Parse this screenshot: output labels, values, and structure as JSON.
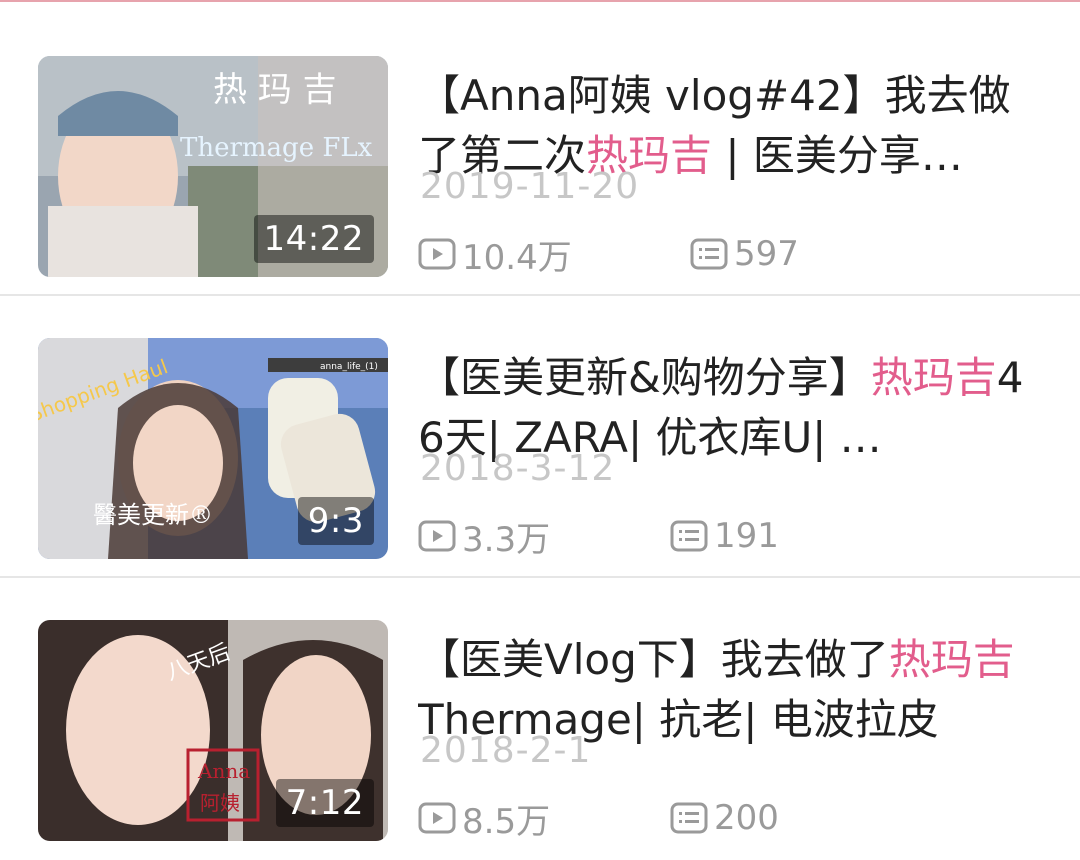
{
  "videos": [
    {
      "duration": "14:22",
      "title_before": "【Anna阿姨 vlog#42】我去做了第二次",
      "title_highlight": "热玛吉",
      "title_after": " | 医美分享…",
      "date": "2019-11-20",
      "views": "10.4万",
      "comments": "597",
      "thumb_text": [
        "热 玛 吉",
        "Thermage FLx"
      ]
    },
    {
      "duration": "9:3",
      "title_before": "【医美更新&购物分享】",
      "title_highlight": "热玛吉",
      "title_after": "46天| ZARA| 优衣库U| …",
      "date": "2018-3-12",
      "views": "3.3万",
      "comments": "191",
      "thumb_text": [
        "Shopping Haul",
        "醫美更新®",
        "anna_life_(1)"
      ]
    },
    {
      "duration": "7:12",
      "title_before": "【医美Vlog下】我去做了",
      "title_highlight": "热玛吉",
      "title_after": "Thermage| 抗老| 电波拉皮",
      "date": "2018-2-1",
      "views": "8.5万",
      "comments": "200",
      "thumb_text": [
        "八天后",
        "Anna",
        "阿姨"
      ]
    }
  ],
  "colors": {
    "highlight": "#e25d8c",
    "meta": "#9a9a9a",
    "date": "#c7c7c7",
    "divider": "#e6e6e6"
  },
  "icons": {
    "views": "play-icon",
    "comments": "comment-icon"
  }
}
